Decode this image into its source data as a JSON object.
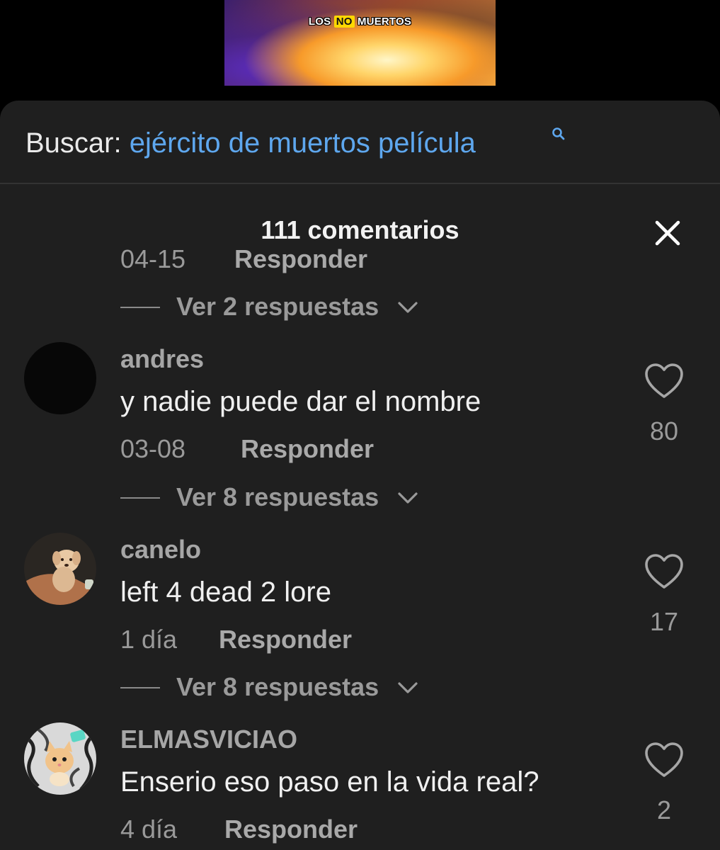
{
  "video": {
    "caption_parts": [
      "LOS",
      "NO",
      "MUERTOS"
    ]
  },
  "search": {
    "prefix": "Buscar:",
    "query": "ejército de muertos película"
  },
  "comments_header": {
    "count_label": "111 comentarios"
  },
  "previous_comment": {
    "date": "04-15",
    "reply_label": "Responder",
    "view_replies_label": "Ver 2 respuestas"
  },
  "comments": [
    {
      "username": "andres",
      "text": "y nadie puede dar el nombre",
      "date": "03-08",
      "reply_label": "Responder",
      "likes": "80",
      "view_replies_label": "Ver 8 respuestas"
    },
    {
      "username": "canelo",
      "text": "left 4 dead 2 lore",
      "date": "1 día",
      "reply_label": "Responder",
      "likes": "17",
      "view_replies_label": "Ver 8 respuestas"
    },
    {
      "username": "ELMASVICIAO",
      "text": "Enserio eso paso en la vida real?",
      "date": "4 día",
      "reply_label": "Responder",
      "likes": "2"
    }
  ],
  "icons": {
    "search": "search-icon",
    "close": "close-icon",
    "heart": "heart-outline-icon",
    "chevron": "chevron-down-icon"
  },
  "colors": {
    "sheet_background": "#1f1f1f",
    "search_query": "#5ea7ee",
    "muted_text": "#9a9a9a"
  }
}
